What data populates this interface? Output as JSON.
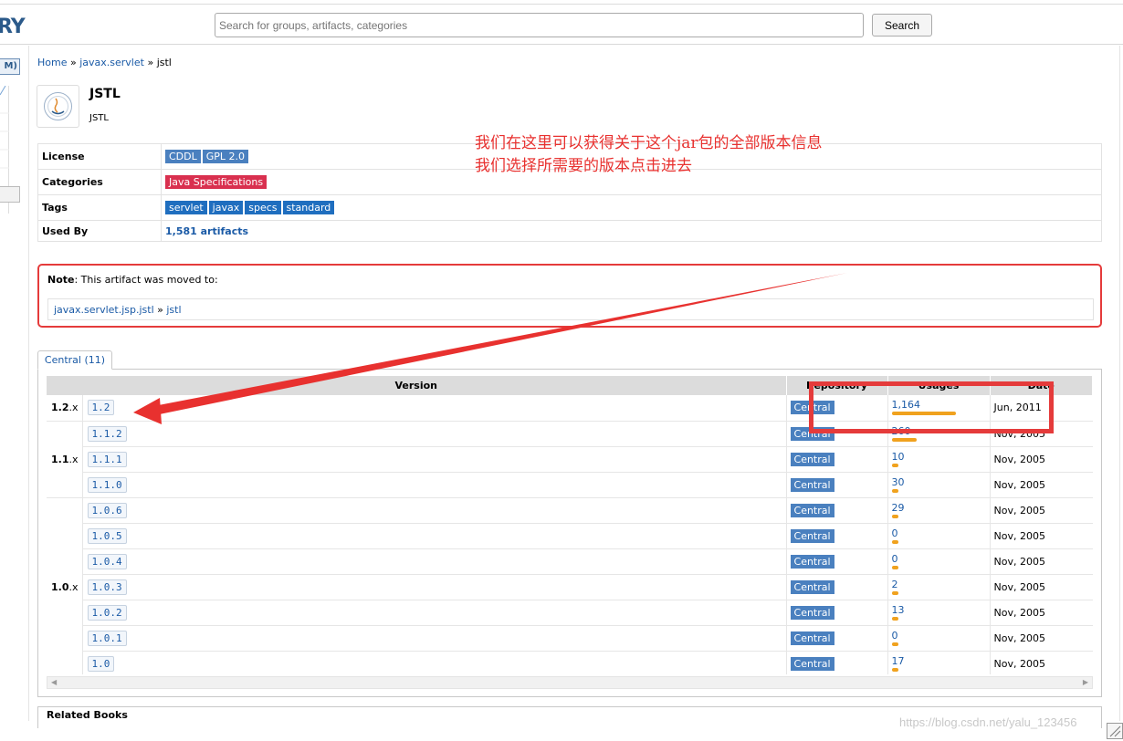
{
  "header": {
    "logo_text": "RY",
    "search_placeholder": "Search for groups, artifacts, categories",
    "search_button": "Search"
  },
  "sidebar": {
    "button_label": "M)"
  },
  "breadcrumb": {
    "home": "Home",
    "group": "javax.servlet",
    "artifact": "jstl",
    "separator": "»"
  },
  "artifact": {
    "title": "JSTL",
    "subtitle": "JSTL"
  },
  "info": {
    "license_label": "License",
    "licenses": [
      "CDDL",
      "GPL 2.0"
    ],
    "categories_label": "Categories",
    "category": "Java Specifications",
    "tags_label": "Tags",
    "tags": [
      "servlet",
      "javax",
      "specs",
      "standard"
    ],
    "used_by_label": "Used By",
    "used_by": "1,581 artifacts"
  },
  "annotation": {
    "line1": "我们在这里可以获得关于这个jar包的全部版本信息",
    "line2": "我们选择所需要的版本点击进去"
  },
  "note": {
    "label": "Note",
    "text": ": This artifact was moved to:",
    "link_group": "javax.servlet.jsp.jstl",
    "link_artifact": "jstl",
    "separator": "»"
  },
  "tab": {
    "label": "Central (11)"
  },
  "versions_table": {
    "headers": {
      "version": "Version",
      "repository": "Repository",
      "usages": "Usages",
      "date": "Date"
    },
    "groups": [
      {
        "major": "1.2",
        "suffix": ".x"
      },
      {
        "major": "1.1",
        "suffix": ".x"
      },
      {
        "major": "1.0",
        "suffix": ".x"
      }
    ],
    "rows": [
      {
        "version": "1.2",
        "repo": "Central",
        "usages": "1,164",
        "usage_fraction": 1.0,
        "date": "Jun, 2011"
      },
      {
        "version": "1.1.2",
        "repo": "Central",
        "usages": "260",
        "usage_fraction": 0.39,
        "date": "Nov, 2005"
      },
      {
        "version": "1.1.1",
        "repo": "Central",
        "usages": "10",
        "usage_fraction": 0.1,
        "date": "Nov, 2005"
      },
      {
        "version": "1.1.0",
        "repo": "Central",
        "usages": "30",
        "usage_fraction": 0.1,
        "date": "Nov, 2005"
      },
      {
        "version": "1.0.6",
        "repo": "Central",
        "usages": "29",
        "usage_fraction": 0.1,
        "date": "Nov, 2005"
      },
      {
        "version": "1.0.5",
        "repo": "Central",
        "usages": "0",
        "usage_fraction": 0.1,
        "date": "Nov, 2005"
      },
      {
        "version": "1.0.4",
        "repo": "Central",
        "usages": "0",
        "usage_fraction": 0.1,
        "date": "Nov, 2005"
      },
      {
        "version": "1.0.3",
        "repo": "Central",
        "usages": "2",
        "usage_fraction": 0.1,
        "date": "Nov, 2005"
      },
      {
        "version": "1.0.2",
        "repo": "Central",
        "usages": "13",
        "usage_fraction": 0.1,
        "date": "Nov, 2005"
      },
      {
        "version": "1.0.1",
        "repo": "Central",
        "usages": "0",
        "usage_fraction": 0.1,
        "date": "Nov, 2005"
      },
      {
        "version": "1.0",
        "repo": "Central",
        "usages": "17",
        "usage_fraction": 0.1,
        "date": "Nov, 2005"
      }
    ]
  },
  "related": {
    "label": "Related Books"
  },
  "watermark": "https://blog.csdn.net/yalu_123456",
  "colors": {
    "accent": "#1f6ebf",
    "annotation": "#e53b3b",
    "usage_bar": "#f0a21e",
    "category": "#d9304f"
  },
  "icons": {
    "artifact_logo": "jcp-logo-icon",
    "scroll_left": "triangle-left-icon",
    "scroll_right": "triangle-right-icon"
  }
}
